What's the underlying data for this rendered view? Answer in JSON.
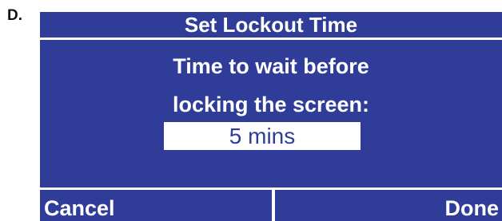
{
  "step_label": "D.",
  "screen": {
    "title": "Set Lockout Time",
    "prompt_line1": "Time to wait before",
    "prompt_line2": "locking the screen:",
    "value": "5 mins"
  },
  "softkeys": {
    "left_label": "Cancel",
    "right_label": "Done"
  },
  "colors": {
    "screen_background": "#2f3d98",
    "text": "#ffffff",
    "value_text": "#2f3d98",
    "value_background": "#ffffff"
  }
}
